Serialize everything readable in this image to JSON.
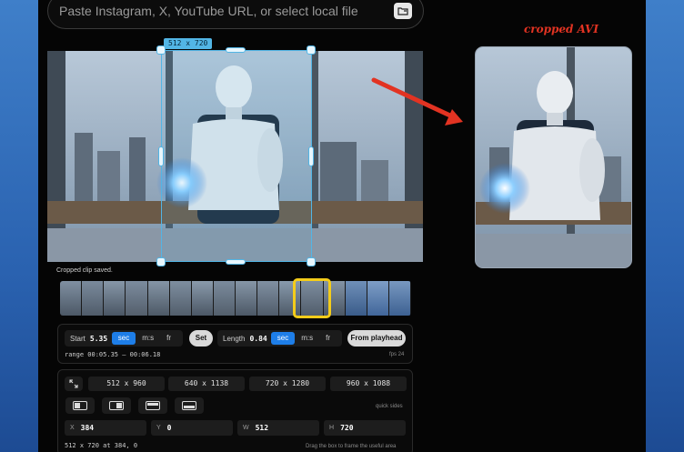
{
  "url_bar": {
    "placeholder": "Paste Instagram, X, YouTube URL, or select local file"
  },
  "crop": {
    "label": "512 x 720"
  },
  "status_text": "Cropped clip saved.",
  "timing": {
    "start_label": "Start",
    "start_value": "5.35",
    "unit_sec": "sec",
    "unit_ms": "m:s",
    "unit_fr": "fr",
    "set_label": "Set",
    "length_label": "Length",
    "length_value": "0.84",
    "from_playhead_label": "From playhead",
    "range_text": "range 00:05.35 – 00:06.18",
    "fps_text": "fps 24"
  },
  "presets": [
    "512 x 960",
    "640 x 1138",
    "720 x 1280",
    "960 x 1088"
  ],
  "quick_sides_label": "quick sides",
  "fields": {
    "x_label": "X",
    "x_value": "384",
    "y_label": "Y",
    "y_value": "0",
    "w_label": "W",
    "w_value": "512",
    "h_label": "H",
    "h_value": "720"
  },
  "summary_text": "512 x 720 at 384, 0",
  "hint_text": "Drag the box to frame the useful area",
  "preview_title": "cropped AVI",
  "colors": {
    "accent": "#1e7ee8",
    "crop": "#52b5e5",
    "playhead": "#f4cc1a",
    "annotation": "#e23322"
  }
}
